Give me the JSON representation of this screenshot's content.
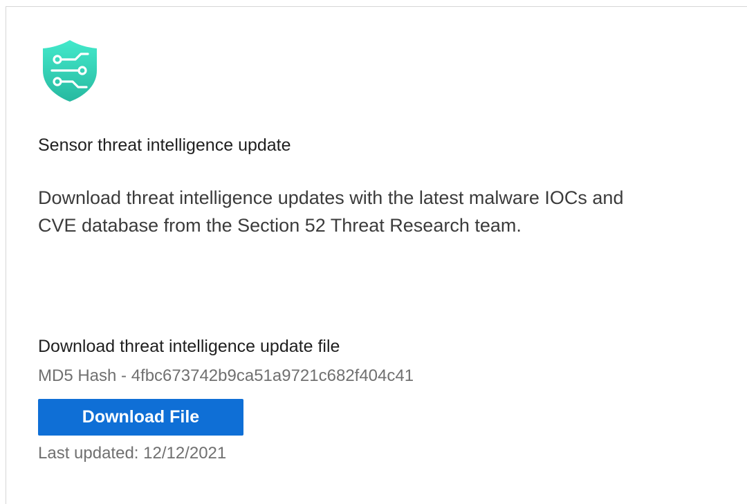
{
  "icon": "shield-circuit-icon",
  "colors": {
    "shield_top": "#3ee6c7",
    "shield_bottom": "#2bbfa6",
    "button_bg": "#0f6fd6",
    "border": "#d6d6d6"
  },
  "card": {
    "title": "Sensor threat intelligence update",
    "description_lines": [
      "Download threat intelligence updates with the latest malware IOCs and",
      "CVE database from the Section 52 Threat Research team."
    ],
    "file_section": {
      "title": "Download threat intelligence update file",
      "hash": "MD5 Hash - 4fbc673742b9ca51a9721c682f404c41",
      "button_label": "Download File",
      "last_updated": "Last updated: 12/12/2021"
    }
  }
}
